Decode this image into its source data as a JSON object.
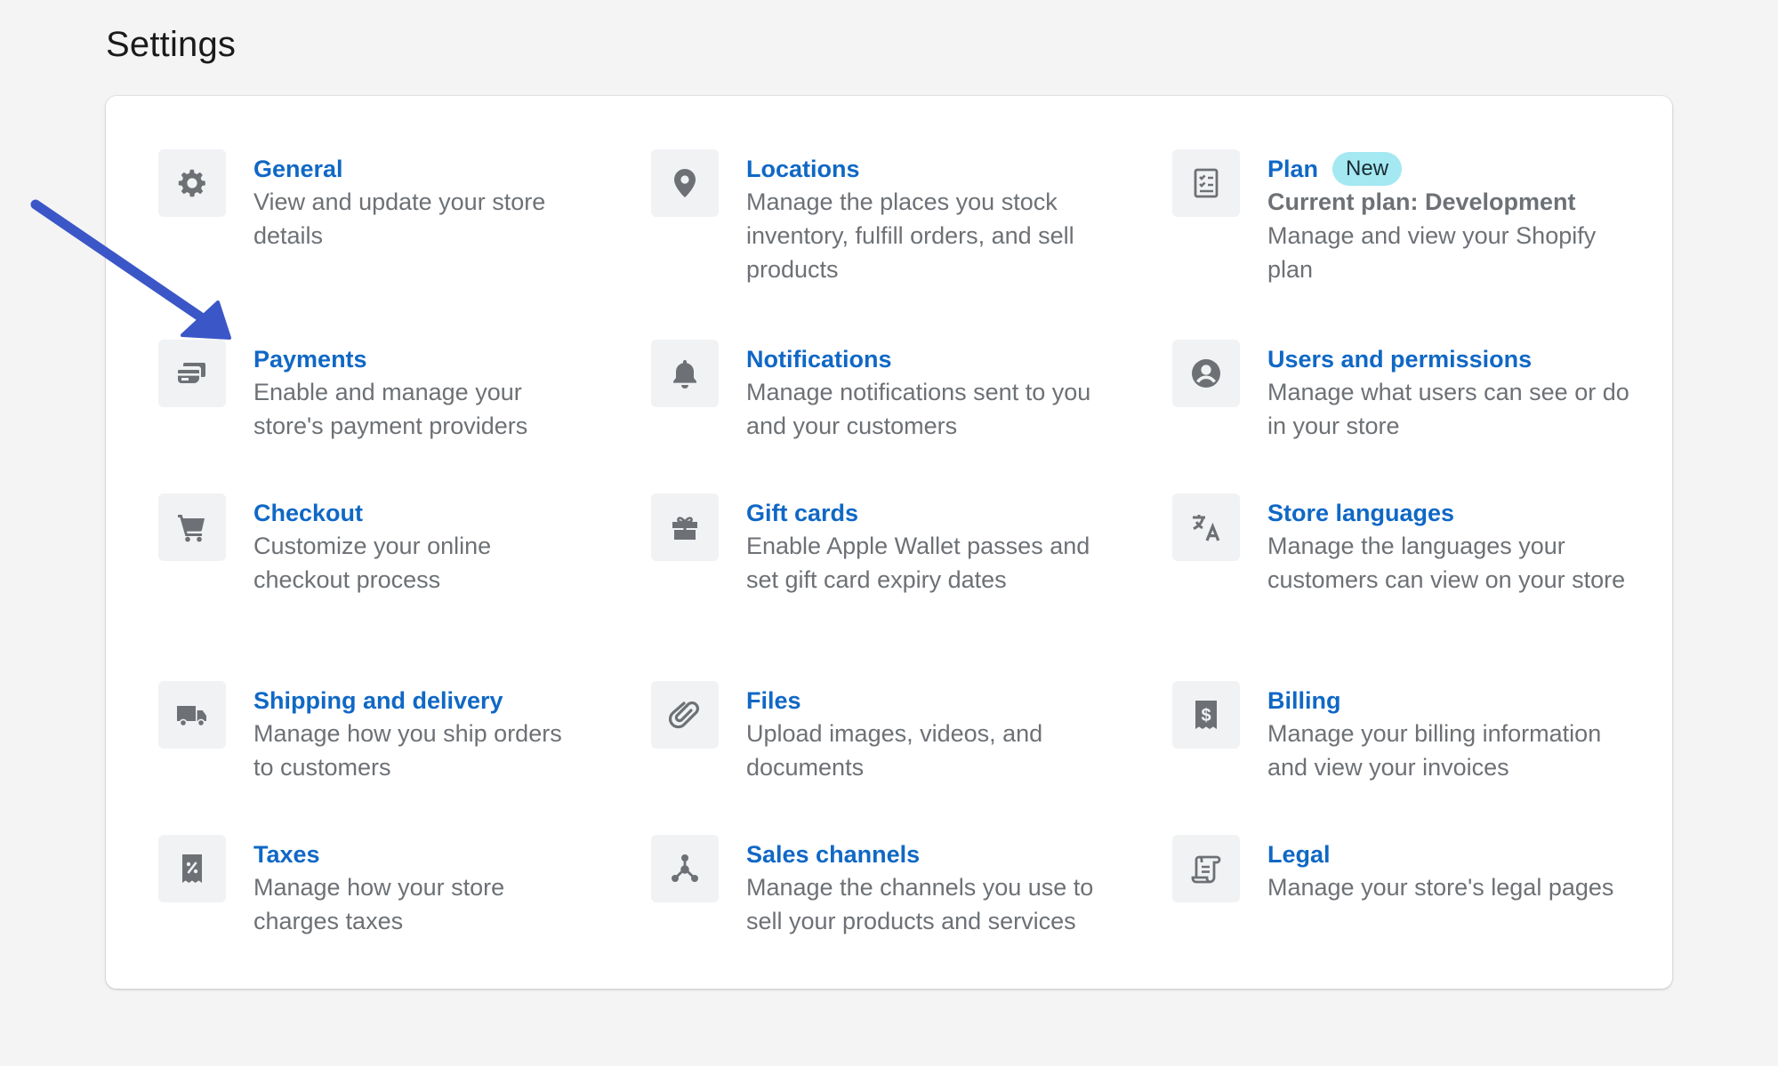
{
  "page": {
    "title": "Settings"
  },
  "colors": {
    "link": "#1068c5",
    "muted": "#6d7175",
    "icon": "#6d7175",
    "badge_bg": "#a4e8f2",
    "arrow": "#4a63d0"
  },
  "settings": [
    {
      "key": "general",
      "icon": "gear-icon",
      "title": "General",
      "description": "View and update your store details"
    },
    {
      "key": "locations",
      "icon": "location-pin-icon",
      "title": "Locations",
      "description": "Manage the places you stock inventory, fulfill orders, and sell products"
    },
    {
      "key": "plan",
      "icon": "plan-checklist-icon",
      "title": "Plan",
      "badge": "New",
      "subtitle": "Current plan: Development",
      "description": "Manage and view your Shopify plan"
    },
    {
      "key": "payments",
      "icon": "payments-card-icon",
      "title": "Payments",
      "description": "Enable and manage your store's payment providers"
    },
    {
      "key": "notifications",
      "icon": "bell-icon",
      "title": "Notifications",
      "description": "Manage notifications sent to you and your customers"
    },
    {
      "key": "users",
      "icon": "user-circle-icon",
      "title": "Users and permissions",
      "description": "Manage what users can see or do in your store"
    },
    {
      "key": "checkout",
      "icon": "cart-icon",
      "title": "Checkout",
      "description": "Customize your online checkout process"
    },
    {
      "key": "gift_cards",
      "icon": "gift-icon",
      "title": "Gift cards",
      "description": "Enable Apple Wallet passes and set gift card expiry dates"
    },
    {
      "key": "languages",
      "icon": "translate-icon",
      "title": "Store languages",
      "description": "Manage the languages your customers can view on your store"
    },
    {
      "key": "shipping",
      "icon": "truck-icon",
      "title": "Shipping and delivery",
      "description": "Manage how you ship orders to customers"
    },
    {
      "key": "files",
      "icon": "paperclip-icon",
      "title": "Files",
      "description": "Upload images, videos, and documents"
    },
    {
      "key": "billing",
      "icon": "billing-receipt-icon",
      "title": "Billing",
      "description": "Manage your billing information and view your invoices"
    },
    {
      "key": "taxes",
      "icon": "tax-receipt-icon",
      "title": "Taxes",
      "description": "Manage how your store charges taxes"
    },
    {
      "key": "sales_channels",
      "icon": "sales-channels-icon",
      "title": "Sales channels",
      "description": "Manage the channels you use to sell your products and services"
    },
    {
      "key": "legal",
      "icon": "legal-scroll-icon",
      "title": "Legal",
      "description": "Manage your store's legal pages"
    }
  ]
}
